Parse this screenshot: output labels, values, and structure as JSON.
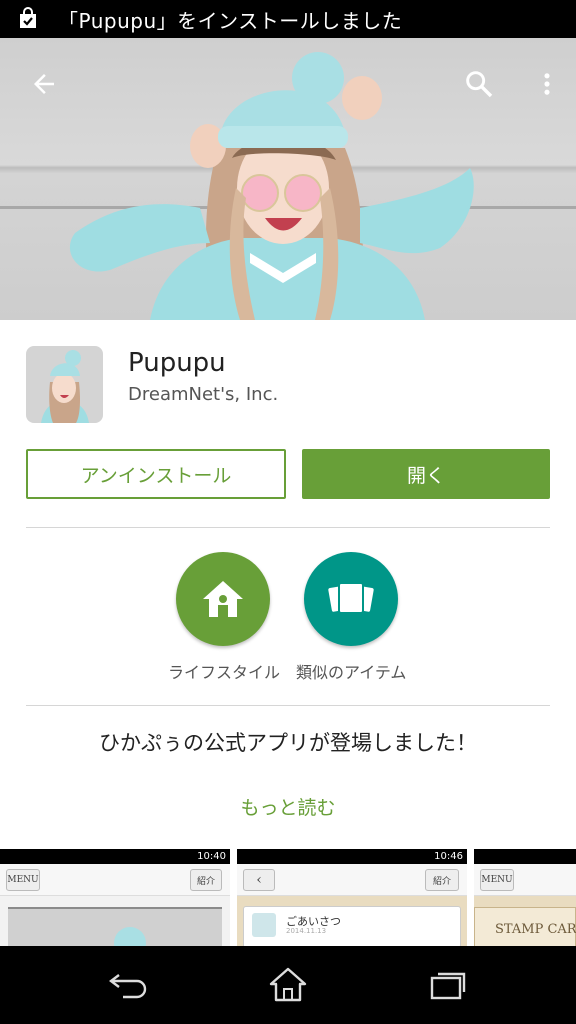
{
  "status_bar": {
    "notification": "「Pupupu」をインストールしました"
  },
  "app": {
    "title": "Pupupu",
    "developer": "DreamNet's, Inc."
  },
  "actions": {
    "uninstall_label": "アンインストール",
    "open_label": "開く"
  },
  "badges": [
    {
      "label": "ライフスタイル",
      "icon": "home-icon"
    },
    {
      "label": "類似のアイテム",
      "icon": "similar-items-icon"
    }
  ],
  "description": "ひかぷぅの公式アプリが登場しました！",
  "more_link": "もっと読む",
  "screenshots": [
    {
      "time": "10:40",
      "menu": "MENU",
      "right_button": "紹介",
      "content": ""
    },
    {
      "time": "10:46",
      "menu": "",
      "right_button": "紹介",
      "content": "ごあいさつ",
      "date": "2014.11.13"
    },
    {
      "time": "",
      "menu": "MENU",
      "right_button": "",
      "content": "STAMP CARD"
    }
  ],
  "colors": {
    "accent_green": "#689f38",
    "teal": "#009688"
  }
}
